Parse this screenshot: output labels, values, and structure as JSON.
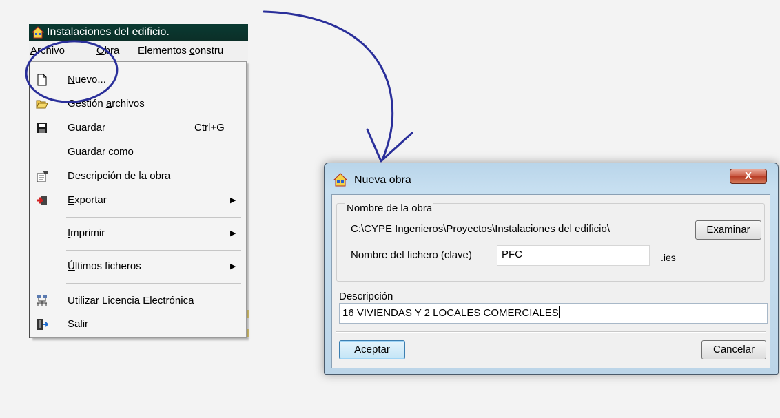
{
  "app": {
    "title": "Instalaciones del edificio.",
    "menubar": [
      {
        "pre": "",
        "ul": "A",
        "post": "rchivo"
      },
      {
        "pre": "",
        "ul": "O",
        "post": "bra"
      },
      {
        "pre": "Elementos ",
        "ul": "c",
        "post": "onstru"
      }
    ]
  },
  "file_menu": {
    "items": [
      {
        "pre": "",
        "ul": "N",
        "post": "uevo...",
        "shortcut": "",
        "icon": "new-file-icon"
      },
      {
        "pre": "Gestión ",
        "ul": "a",
        "post": "rchivos",
        "shortcut": "",
        "icon": "folder-open-icon"
      },
      {
        "pre": "",
        "ul": "G",
        "post": "uardar",
        "shortcut": "Ctrl+G",
        "icon": "save-icon"
      },
      {
        "pre": "Guardar ",
        "ul": "c",
        "post": "omo",
        "shortcut": "",
        "icon": ""
      },
      {
        "pre": "",
        "ul": "D",
        "post": "escripción de la obra",
        "shortcut": "",
        "icon": "properties-icon"
      },
      {
        "pre": "",
        "ul": "E",
        "post": "xportar",
        "shortcut": "",
        "icon": "export-icon",
        "submenu": true
      },
      {
        "pre": "",
        "ul": "I",
        "post": "mprimir",
        "shortcut": "",
        "icon": "",
        "submenu": true
      },
      {
        "pre": "",
        "ul": "Ú",
        "post": "ltimos ficheros",
        "shortcut": "",
        "icon": "",
        "submenu": true
      },
      {
        "pre": "Utilizar Licencia Electrónica",
        "ul": "",
        "post": "",
        "shortcut": "",
        "icon": "network-license-icon"
      },
      {
        "pre": "",
        "ul": "S",
        "post": "alir",
        "shortcut": "",
        "icon": "exit-icon"
      }
    ],
    "submenu_arrow": "▶"
  },
  "dialog": {
    "title": "Nueva obra",
    "close_label": "X",
    "group_label": "Nombre de la obra",
    "path": "C:\\CYPE Ingenieros\\Proyectos\\Instalaciones del edificio\\",
    "browse_label": "Examinar",
    "file_label": "Nombre del fichero (clave)",
    "file_value": "PFC",
    "extension": ".ies",
    "description_label": "Descripción",
    "description_value": "16 VIVIENDAS Y 2 LOCALES COMERCIALES",
    "accept_label": "Aceptar",
    "cancel_label": "Cancelar"
  },
  "colors": {
    "annotation": "#2a2f9a",
    "titlebar": "#0b3530",
    "dialog_frame": "#bcd5e8"
  }
}
